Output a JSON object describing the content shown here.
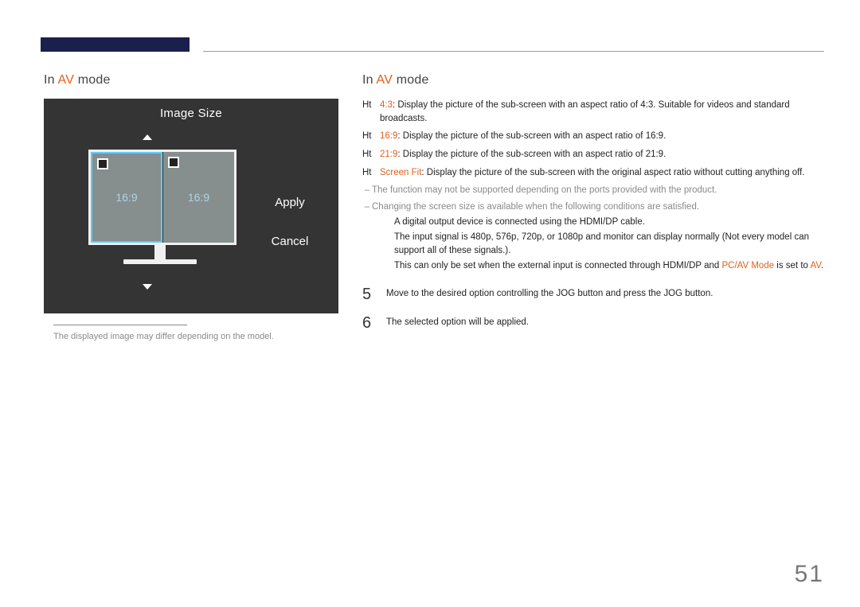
{
  "left": {
    "section_prefix": "In ",
    "section_hl": "AV",
    "section_suffix": " mode",
    "osd_title": "Image Size",
    "ratio_left": "16:9",
    "ratio_right": "16:9",
    "apply": "Apply",
    "cancel": "Cancel",
    "footnote": "The displayed image may differ depending on the model."
  },
  "right": {
    "section_prefix": "In ",
    "section_hl": "AV",
    "section_suffix": " mode",
    "items": [
      {
        "tag": "Ht",
        "ratio": "4:3",
        "text": ": Display the picture of the sub-screen with an aspect ratio of 4:3. Suitable for videos and standard broadcasts."
      },
      {
        "tag": "Ht",
        "ratio": "16:9",
        "text": ": Display the picture of the sub-screen with an aspect ratio of 16:9."
      },
      {
        "tag": "Ht",
        "ratio": "21:9",
        "text": ": Display the picture of the sub-screen with an aspect ratio of 21:9."
      },
      {
        "tag": "Ht",
        "ratio": "Screen Fit",
        "text": ": Display the picture of the sub-screen with the original aspect ratio without cutting anything off."
      }
    ],
    "dashes": [
      "The function may not be supported depending on the ports provided with the product.",
      "Changing the screen size is available when the following conditions are satisfied."
    ],
    "subs": [
      "A digital output device is connected using the HDMI/DP cable.",
      "The input signal is 480p, 576p, 720p, or 1080p and monitor can display normally (Not every model can support all of these signals.).",
      "This can only be set when the external input is connected through HDMI/DP and"
    ],
    "sub3_hl1": "PC/AV Mode",
    "sub3_mid": " is set to ",
    "sub3_hl2": "AV",
    "sub3_end": ".",
    "steps": [
      {
        "num": "5",
        "text": "Move to the desired option controlling the JOG button and press the JOG button."
      },
      {
        "num": "6",
        "text": "The selected option will be applied."
      }
    ]
  },
  "page_number": "51"
}
